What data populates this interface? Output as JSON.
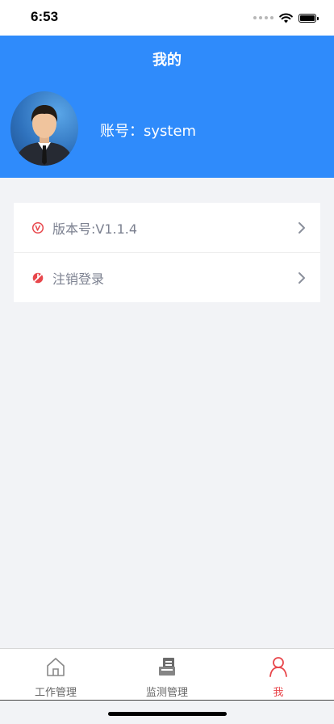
{
  "status_bar": {
    "time": "6:53"
  },
  "header": {
    "title": "我的",
    "account_text": "账号：system"
  },
  "menu": {
    "items": [
      {
        "label": "版本号:V1.1.4",
        "icon": "version-icon"
      },
      {
        "label": "注销登录",
        "icon": "logout-icon"
      }
    ]
  },
  "tabs": [
    {
      "label": "工作管理",
      "icon": "home-icon"
    },
    {
      "label": "监测管理",
      "icon": "monitor-icon"
    },
    {
      "label": "我",
      "icon": "user-icon"
    }
  ],
  "colors": {
    "header_bg": "#2f8bfb",
    "accent_red": "#e8474c",
    "page_bg": "#f2f3f6"
  }
}
